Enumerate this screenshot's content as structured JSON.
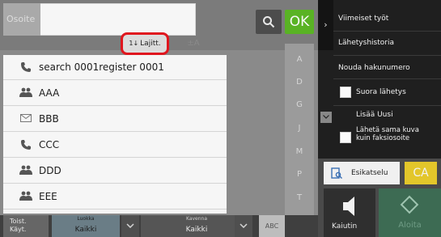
{
  "address": {
    "placeholder": "Osoite",
    "value": ""
  },
  "toolbar": {
    "ok_label": "OK",
    "sort_label": "Lajitt.",
    "sort_icon": "1↓",
    "az_icon": "±A"
  },
  "list": {
    "items": [
      {
        "icon": "phone-icon",
        "glyph": "📞",
        "label": "search 0001register 0001"
      },
      {
        "icon": "group-icon",
        "glyph": "👥",
        "label": "AAA"
      },
      {
        "icon": "email-icon",
        "glyph": "✉",
        "label": "BBB"
      },
      {
        "icon": "phone-icon",
        "glyph": "📞",
        "label": "CCC"
      },
      {
        "icon": "group-icon",
        "glyph": "👥",
        "label": "DDD"
      },
      {
        "icon": "group-icon",
        "glyph": "👥",
        "label": "EEE"
      }
    ]
  },
  "index_letters": [
    "A",
    "D",
    "G",
    "J",
    "M",
    "P",
    "T",
    "W"
  ],
  "bottom": {
    "toist_line1": "Toist.",
    "toist_line2": "Käyt.",
    "luokka_label": "Luokka",
    "luokka_value": "Kaikki",
    "kavenna_label": "Kavenna",
    "kavenna_value": "Kaikki",
    "abc_label": "ABC"
  },
  "panel": {
    "menu": [
      "Viimeiset työt",
      "Lähetyshistoria",
      "Nouda hakunumero"
    ],
    "direct_send": "Suora lähetys",
    "add_new": "Lisää Uusi",
    "same_image_line1": "Lähetä sama kuva",
    "same_image_line2": "kuin faksiosoite",
    "preview": "Esikatselu",
    "ca": "CA",
    "speaker": "Kaiutin",
    "start": "Aloita"
  },
  "colors": {
    "ok": "#59b324",
    "ca": "#e3c62a",
    "sort_highlight": "#e0161e",
    "start": "#3d6b53"
  }
}
